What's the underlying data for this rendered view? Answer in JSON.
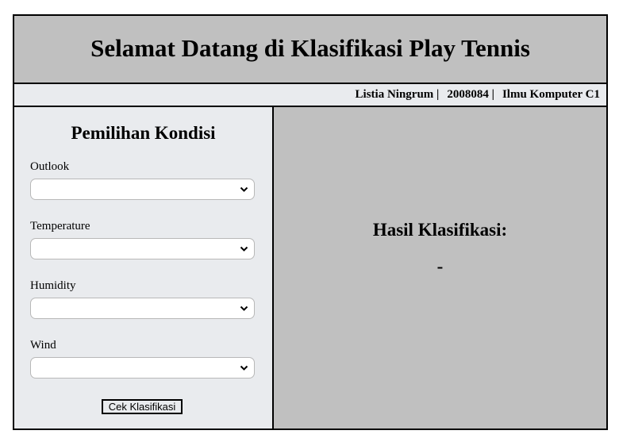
{
  "header": {
    "title": "Selamat Datang di Klasifikasi Play Tennis"
  },
  "info_bar": {
    "name": "Listia Ningrum |",
    "id": "2008084 |",
    "class": "Ilmu Komputer C1"
  },
  "form": {
    "title": "Pemilihan Kondisi",
    "fields": [
      {
        "label": "Outlook",
        "value": ""
      },
      {
        "label": "Temperature",
        "value": ""
      },
      {
        "label": "Humidity",
        "value": ""
      },
      {
        "label": "Wind",
        "value": ""
      }
    ],
    "select_icon": "chevron-down-icon",
    "submit_label": "Cek Klasifikasi"
  },
  "result": {
    "title": "Hasil Klasifikasi:",
    "value": "-"
  }
}
